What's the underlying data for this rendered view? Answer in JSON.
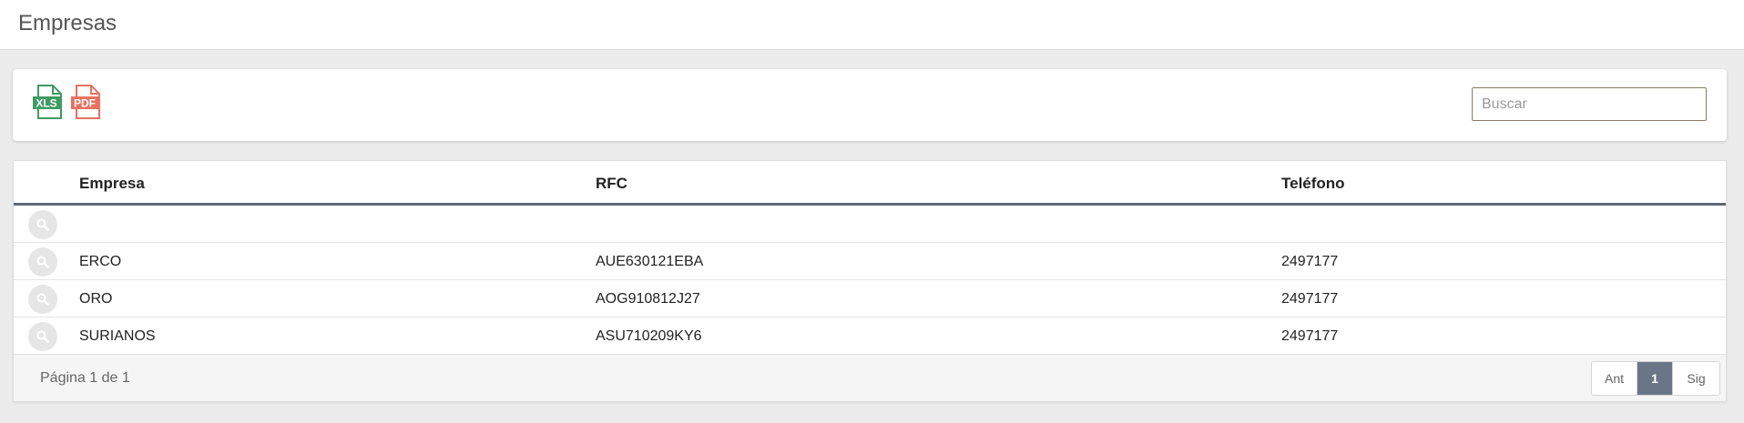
{
  "header": {
    "title": "Empresas"
  },
  "toolbar": {
    "export_xls_label": "XLS",
    "export_pdf_label": "PDF",
    "search": {
      "placeholder": "Buscar",
      "value": ""
    },
    "colors": {
      "xls": "#3f9a63",
      "pdf": "#e8715f",
      "search_border": "#8a7a64"
    }
  },
  "table": {
    "columns": [
      "Empresa",
      "RFC",
      "Teléfono"
    ],
    "rows": [
      {
        "empresa": "",
        "rfc": "",
        "telefono": ""
      },
      {
        "empresa": "ERCO",
        "rfc": "AUE630121EBA",
        "telefono": "2497177"
      },
      {
        "empresa": "ORO",
        "rfc": "AOG910812J27",
        "telefono": "2497177"
      },
      {
        "empresa": "SURIANOS",
        "rfc": "ASU710209KY6",
        "telefono": "2497177"
      }
    ],
    "row_icon": "search-icon"
  },
  "footer": {
    "page_info": "Página 1 de 1",
    "pager": {
      "prev": "Ant",
      "current": "1",
      "next": "Sig"
    },
    "colors": {
      "current_page_bg": "#6a7687"
    }
  }
}
